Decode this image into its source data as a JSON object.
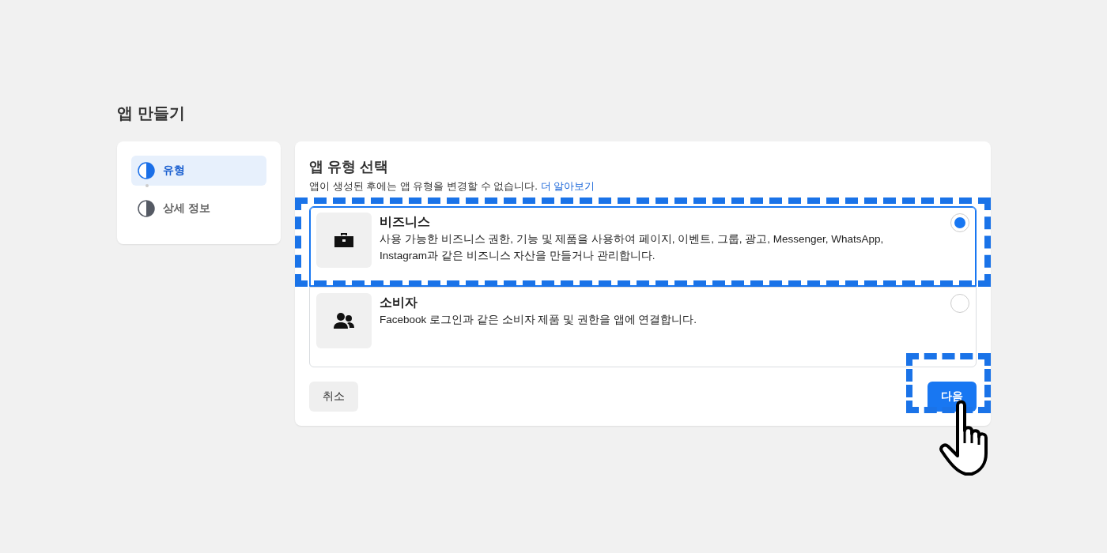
{
  "page_title": "앱 만들기",
  "steps": [
    {
      "label": "유형",
      "selected": true
    },
    {
      "label": "상세 정보",
      "selected": false
    }
  ],
  "panel": {
    "title": "앱 유형 선택",
    "subtitle": "앱이 생성된 후에는 앱 유형을 변경할 수 없습니다.",
    "link": "더 알아보기"
  },
  "options": [
    {
      "kind": "business",
      "title": "비즈니스",
      "description": "사용 가능한 비즈니스 권한, 기능 및 제품을 사용하여 페이지, 이벤트, 그룹, 광고, Messenger, WhatsApp, Instagram과 같은 비즈니스 자산을 만들거나 관리합니다.",
      "selected": true,
      "highlighted": true
    },
    {
      "kind": "consumer",
      "title": "소비자",
      "description": "Facebook 로그인과 같은 소비자 제품 및 권한을 앱에 연결합니다.",
      "selected": false,
      "highlighted": false
    }
  ],
  "buttons": {
    "cancel": "취소",
    "next": "다음",
    "next_highlighted": true
  }
}
